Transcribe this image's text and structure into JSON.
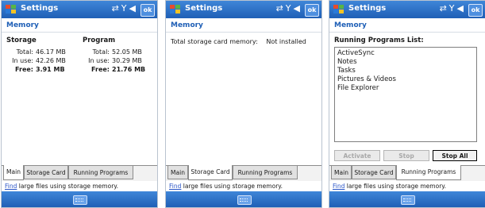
{
  "title": "Settings",
  "ok_label": "ok",
  "section_title": "Memory",
  "tabs": [
    "Main",
    "Storage Card",
    "Running Programs"
  ],
  "find": {
    "link": "Find",
    "text": " large files using storage memory."
  },
  "main": {
    "storage": {
      "heading": "Storage",
      "total_label": "Total:",
      "total": "46.17 MB",
      "inuse_label": "In use:",
      "inuse": "42.26 MB",
      "free_label": "Free:",
      "free": "3.91 MB"
    },
    "program": {
      "heading": "Program",
      "total_label": "Total:",
      "total": "52.05 MB",
      "inuse_label": "In use:",
      "inuse": "30.29 MB",
      "free_label": "Free:",
      "free": "21.76 MB"
    }
  },
  "storage_card": {
    "label": "Total storage card memory:",
    "value": "Not installed"
  },
  "running": {
    "list_label": "Running Programs List:",
    "items": [
      "ActiveSync",
      "Notes",
      "Tasks",
      "Pictures & Videos",
      "File Explorer"
    ],
    "activate": "Activate",
    "stop": "Stop",
    "stop_all": "Stop All"
  },
  "colors": {
    "title_bar": "#1f5fb6",
    "header_text": "#1f5fb6",
    "link": "#2a55c7"
  },
  "icons": {
    "start": "windows-flag-icon",
    "connectivity": "connectivity-icon",
    "signal": "signal-icon",
    "volume": "volume-icon",
    "keyboard": "keyboard-icon"
  }
}
